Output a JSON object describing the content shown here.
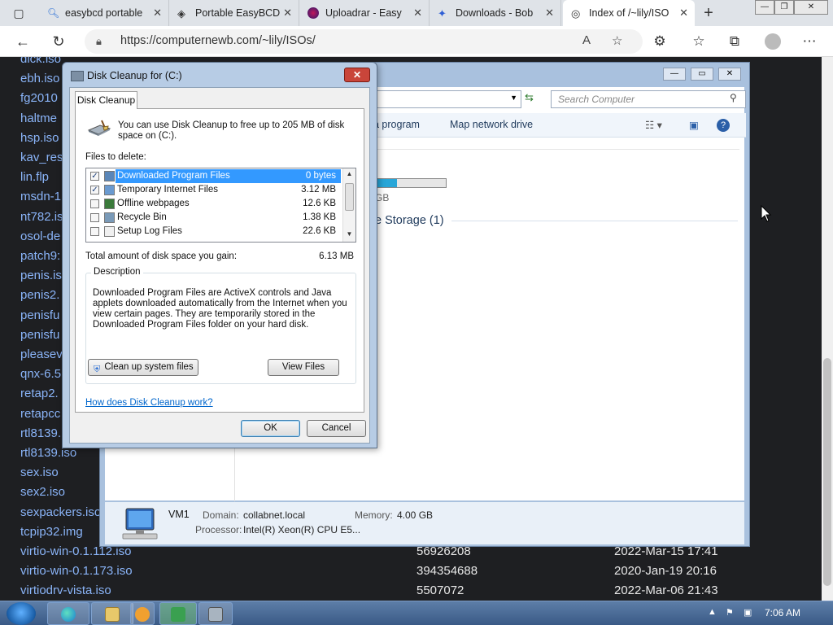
{
  "browser": {
    "tabs": [
      {
        "label": "easybcd portable",
        "icon": "search-icon"
      },
      {
        "label": "Portable EasyBCD",
        "icon": "diamond-icon"
      },
      {
        "label": "Uploadrar - Easy",
        "icon": "uploadrar-icon"
      },
      {
        "label": "Downloads - Bob",
        "icon": "puzzle-icon"
      },
      {
        "label": "Index of /~lily/ISO",
        "icon": "page-icon"
      }
    ],
    "url": "https://computernewb.com/~lily/ISOs/"
  },
  "listing": {
    "names": [
      "dick.iso",
      "ebh.iso",
      "fg2010",
      "haltme",
      "hsp.iso",
      "kav_res",
      "lin.flp",
      "msdn-1",
      "nt782.is",
      "osol-de",
      "patch9:",
      "penis.is",
      "penis2.",
      "penisfu",
      "penisfu",
      "pleasev",
      "qnx-6.5",
      "retap2.",
      "retapcc",
      "rtl8139.",
      "rtl8139.iso",
      "sex.iso",
      "sex2.iso",
      "sexpackers.iso",
      "tcpip32.img",
      "virtio-win-0.1.112.iso",
      "virtio-win-0.1.173.iso",
      "virtiodrv-vista.iso"
    ],
    "bottom_rows": [
      {
        "size": "56926208",
        "date": "2022-Mar-15 17:41"
      },
      {
        "size": "394354688",
        "date": "2020-Jan-19 20:16"
      },
      {
        "size": "5507072",
        "date": "2022-Mar-06 21:43"
      }
    ]
  },
  "computer_window": {
    "search_placeholder": "Search Computer",
    "cmd_program": "a program",
    "cmd_map": "Map network drive",
    "drive_size_fragment": "GB",
    "storage_group": "e Storage (1)",
    "storage_fill_fraction": 0.32,
    "status": {
      "name": "VM1",
      "domain_label": "Domain:",
      "domain": "collabnet.local",
      "memory_label": "Memory:",
      "memory": "4.00 GB",
      "processor_label": "Processor:",
      "processor": "Intel(R) Xeon(R) CPU E5..."
    }
  },
  "dialog": {
    "title": "Disk Cleanup for  (C:)",
    "close": "✕",
    "tab": "Disk Cleanup",
    "intro": "You can use Disk Cleanup to free up to 205 MB of disk space on  (C:).",
    "files_to_delete": "Files to delete:",
    "files": [
      {
        "name": "Downloaded Program Files",
        "size": "0 bytes",
        "checked": true,
        "selected": true
      },
      {
        "name": "Temporary Internet Files",
        "size": "3.12 MB",
        "checked": true,
        "selected": false
      },
      {
        "name": "Offline webpages",
        "size": "12.6 KB",
        "checked": false,
        "selected": false
      },
      {
        "name": "Recycle Bin",
        "size": "1.38 KB",
        "checked": false,
        "selected": false
      },
      {
        "name": "Setup Log Files",
        "size": "22.6 KB",
        "checked": false,
        "selected": false
      }
    ],
    "total_label": "Total amount of disk space you gain:",
    "total_value": "6.13 MB",
    "description_label": "Description",
    "description": "Downloaded Program Files are ActiveX controls and Java applets downloaded automatically from the Internet when you view certain pages. They are temporarily stored in the Downloaded Program Files folder on your hard disk.",
    "cleanup_system": "Clean up system files",
    "view_files": "View Files",
    "help_link": "How does Disk Cleanup work?",
    "ok": "OK",
    "cancel": "Cancel"
  },
  "taskbar": {
    "clock": "7:06 AM"
  },
  "colors": {
    "accent": "#3399ff",
    "link": "#8ab4f8",
    "page_bg": "#1e1f22"
  }
}
